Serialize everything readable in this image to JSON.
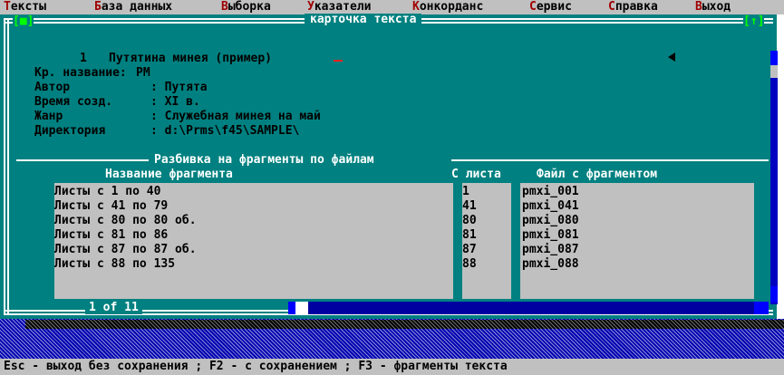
{
  "menu": {
    "items": [
      {
        "hot": "Т",
        "rest": "ексты"
      },
      {
        "hot": "Б",
        "rest": "аза данных"
      },
      {
        "hot": "В",
        "rest": "ыборка"
      },
      {
        "hot": "У",
        "rest": "казатели"
      },
      {
        "hot": "К",
        "rest": "онкорданс"
      },
      {
        "hot": "С",
        "rest": "ервис"
      },
      {
        "hot": "С",
        "rest": "правка"
      },
      {
        "hot": "В",
        "rest": "ыход"
      }
    ]
  },
  "window": {
    "title": "карточка текста",
    "close_icon": "[■]",
    "resize_icon": "[↑]"
  },
  "card": {
    "number": "1",
    "name": "Путятина минея (пример)",
    "fields": [
      {
        "label": "Кр. название:",
        "value": "PM"
      },
      {
        "label": "Автор",
        "value": ": Путята"
      },
      {
        "label": "Время созд.",
        "value": ": XI в."
      },
      {
        "label": "Жанр",
        "value": ": Служебная минея на май"
      },
      {
        "label": "Директория",
        "value": ": d:\\Prms\\f45\\SAMPLE\\"
      }
    ]
  },
  "fragments": {
    "section_title": "Разбивка на фрагменты по файлам",
    "columns": {
      "name": "Название фрагмента",
      "sheet": "С листа",
      "file": "Файл с фрагментом"
    },
    "rows": [
      {
        "name": "Листы с 1 по 40",
        "sheet": "1",
        "file": "pmxi_001"
      },
      {
        "name": "Листы с 41 по 79",
        "sheet": "41",
        "file": "pmxi_041"
      },
      {
        "name": "Листы с 80 по 80 об.",
        "sheet": "80",
        "file": "pmxi_080"
      },
      {
        "name": "Листы с 81 по 86",
        "sheet": "81",
        "file": "pmxi_081"
      },
      {
        "name": "Листы с 87 по 87 об.",
        "sheet": "87",
        "file": "pmxi_087"
      },
      {
        "name": "Листы с 88 по 135",
        "sheet": "88",
        "file": "pmxi_088"
      }
    ]
  },
  "pager": "1 of 11",
  "status_bar": "Esc - выход без сохранения ; F2 - с сохранением ; F3 - фрагменты текста",
  "colors": {
    "window_bg": "#008080",
    "menu_bg": "#c0c0c0",
    "hotkey": "#a00000",
    "scroll": "#0000ff",
    "desktop": "#0000b0"
  }
}
